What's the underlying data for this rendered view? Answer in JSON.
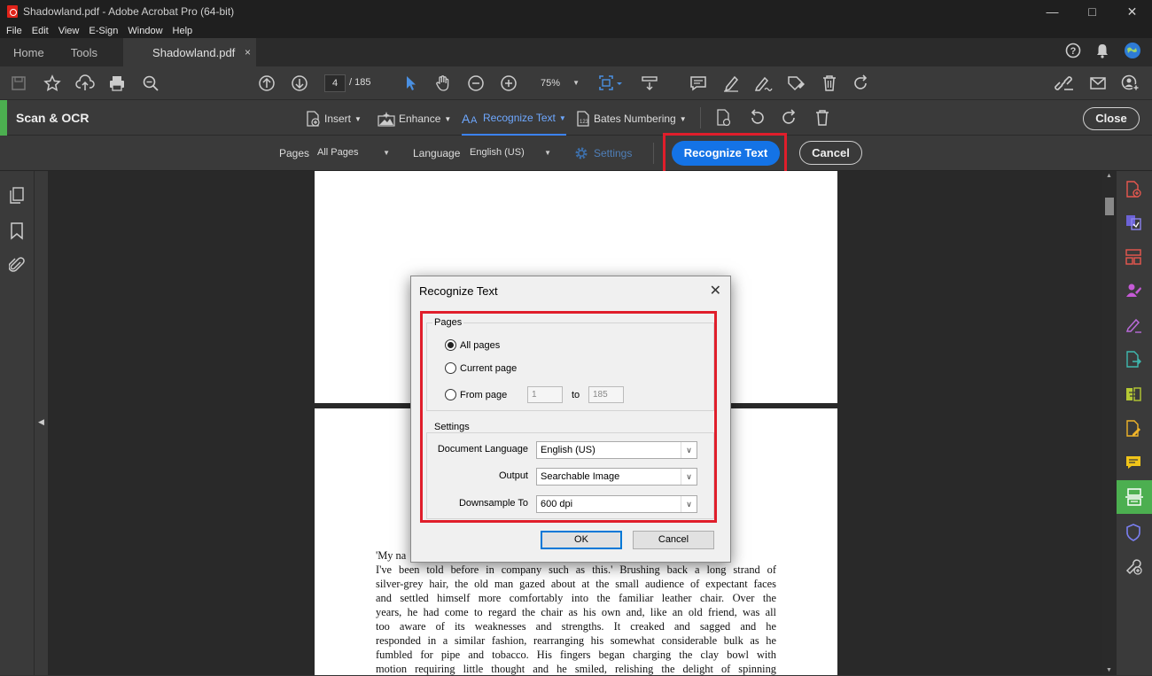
{
  "window": {
    "title": "Shadowland.pdf - Adobe Acrobat Pro (64-bit)",
    "controls": [
      "minimize",
      "maximize",
      "close"
    ]
  },
  "menu": [
    "File",
    "Edit",
    "View",
    "E-Sign",
    "Window",
    "Help"
  ],
  "tabs": {
    "home": "Home",
    "tools": "Tools",
    "document": "Shadowland.pdf",
    "close_glyph": "×"
  },
  "toolbar": {
    "current_page": "4",
    "page_total": "/ 185",
    "zoom": "75%"
  },
  "scan_ocr": {
    "title": "Scan & OCR",
    "tools": [
      {
        "label": "Insert",
        "active": false
      },
      {
        "label": "Enhance",
        "active": false
      },
      {
        "label": "Recognize Text",
        "active": true
      },
      {
        "label": "Bates Numbering",
        "active": false
      }
    ],
    "close_label": "Close"
  },
  "options": {
    "pages_label": "Pages",
    "pages_value": "All Pages",
    "language_label": "Language",
    "language_value": "English (US)",
    "settings_label": "Settings",
    "recognize_label": "Recognize Text",
    "cancel_label": "Cancel"
  },
  "dialog": {
    "title": "Recognize Text",
    "pages_group": "Pages",
    "radio_all": "All pages",
    "radio_current": "Current page",
    "radio_from": "From page",
    "from_value": "1",
    "to_label": "to",
    "to_value": "185",
    "selected_radio": "all",
    "settings_group": "Settings",
    "doc_language_label": "Document Language",
    "doc_language_value": "English (US)",
    "output_label": "Output",
    "output_value": "Searchable Image",
    "downsample_label": "Downsample To",
    "downsample_value": "600 dpi",
    "ok_label": "OK",
    "cancel_label": "Cancel"
  },
  "book_text": [
    "'My na                                                                            ife, or so",
    "I've been told before in company such as this.' Brushing back a long strand of",
    "silver-grey hair, the old man gazed about at the small audience of expectant faces",
    "and settled himself more comfortably into the familiar leather chair. Over the",
    "years, he had come to regard the chair as his own and, like an old friend, was all",
    "too aware of its weaknesses and strengths. It creaked and sagged and he",
    "responded in a similar fashion, rearranging his somewhat considerable bulk as he",
    "fumbled for pipe and tobacco. His fingers began charging the clay bowl with",
    "motion requiring little thought and he smiled, relishing the delight of spinning"
  ],
  "colors": {
    "accent_blue": "#1473e6",
    "highlight_red": "#e01e2b",
    "scan_green": "#4caf50"
  }
}
